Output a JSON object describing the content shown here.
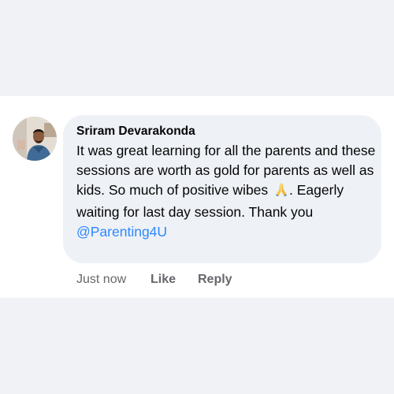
{
  "comment": {
    "author": "Sriram Devarakonda",
    "text_before_emoji": "It was great learning for all the parents and these sessions are worth as gold for parents as well as kids. So much of positive wibes ",
    "emoji_icon": "folded-hands-emoji",
    "text_after_emoji": ". Eagerly waiting for last day session. Thank you ",
    "mention": "@Parenting4U"
  },
  "actions": {
    "timestamp": "Just now",
    "like_label": "Like",
    "reply_label": "Reply"
  },
  "colors": {
    "background": "#f0f2f5",
    "bubble": "#eef1f6",
    "text": "#050505",
    "meta": "#65676b",
    "link": "#2d88ff"
  }
}
